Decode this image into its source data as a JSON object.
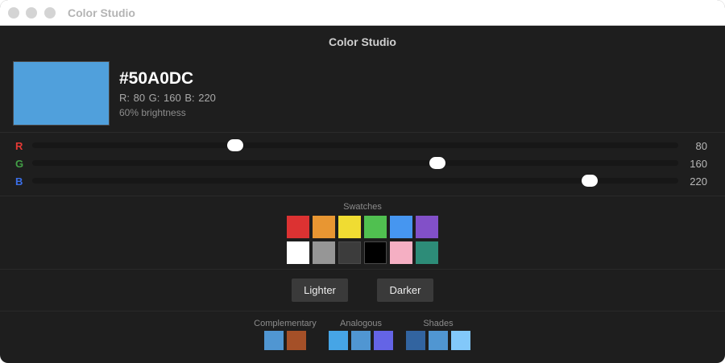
{
  "window": {
    "title": "Color Studio"
  },
  "app": {
    "title": "Color Studio"
  },
  "current": {
    "hex": "#50A0DC",
    "color": "#50A0DC",
    "rgb_text": "R: 80  G: 160  B: 220",
    "brightness_text": "60% brightness"
  },
  "channels": [
    {
      "label": "R",
      "value": "80",
      "level": 80,
      "color": "#e53935"
    },
    {
      "label": "G",
      "value": "160",
      "level": 160,
      "color": "#43a047"
    },
    {
      "label": "B",
      "value": "220",
      "level": 220,
      "color": "#3b6fe8"
    }
  ],
  "channel_max": 255,
  "swatches": {
    "title": "Swatches",
    "colors": [
      "#dc3232",
      "#e89632",
      "#f0dc32",
      "#50c050",
      "#4696f0",
      "#8250c8",
      "#ffffff",
      "#969696",
      "#3c3c3c",
      "#000000",
      "#f5afc3",
      "#2d8c78"
    ]
  },
  "buttons": {
    "lighter": "Lighter",
    "darker": "Darker"
  },
  "harmonies": {
    "complementary": {
      "label": "Complementary",
      "colors": [
        "#5096d2",
        "#a55028"
      ]
    },
    "analogous": {
      "label": "Analogous",
      "colors": [
        "#46a5e6",
        "#5096d2",
        "#6464e6"
      ]
    },
    "shades": {
      "label": "Shades",
      "colors": [
        "#3264a0",
        "#5096d2",
        "#82c8fa"
      ]
    }
  }
}
